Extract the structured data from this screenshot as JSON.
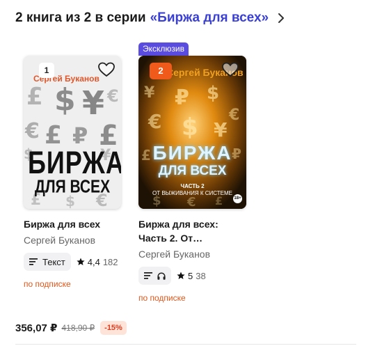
{
  "series": {
    "count_text": "2 книга из 2 в серии",
    "series_name": "«Биржа для всех»"
  },
  "books": [
    {
      "number": "1",
      "cover_author": "Сергей Буканов",
      "cover_title_line1": "БИРЖА",
      "cover_title_line2": "ДЛЯ ВСЕХ",
      "title": "Биржа для всех",
      "author": "Сергей Буканов",
      "format": "Текст",
      "rating": "4,4",
      "rating_count": "182",
      "availability": "по подписке"
    },
    {
      "number": "2",
      "badge": "Эксклюзив",
      "cover_author": "Сергей Буканов",
      "cover_title_line1": "БИРЖА",
      "cover_title_line2": "ДЛЯ ВСЕХ",
      "cover_subtitle_line1": "ЧАСТЬ 2",
      "cover_subtitle_line2": "ОТ ВЫЖИВАНИЯ К СИСТЕМЕ",
      "cover_age": "18+",
      "title": "Биржа для всех: Часть 2. От…",
      "author": "Сергей Буканов",
      "formats": [
        "text-icon",
        "headphones-icon"
      ],
      "rating": "5",
      "rating_count": "38",
      "availability": "по подписке"
    }
  ],
  "price": {
    "current": "356,07 ₽",
    "old": "418,90 ₽",
    "discount": "-15%"
  },
  "colors": {
    "series_link": "#3a3fd6",
    "subscription": "#e0561a",
    "exclusive_badge": "#5b4ce0",
    "number_badge_orange": "#f05a1a"
  }
}
